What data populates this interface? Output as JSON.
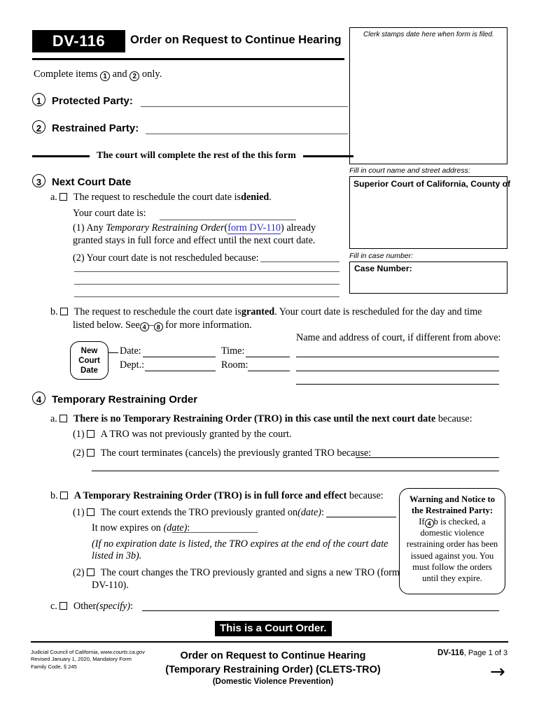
{
  "header": {
    "form_code": "DV-116",
    "title": "Order on Request to Continue Hearing",
    "complete_items_prefix": "Complete items",
    "complete_items_mid": "and",
    "complete_items_suffix": "only.",
    "item1": "1",
    "item2": "2"
  },
  "clerk_box": {
    "label": "Clerk stamps date here when form is filed."
  },
  "parties": {
    "num1": "1",
    "label1": "Protected Party:",
    "num2": "2",
    "label2": "Restrained Party:",
    "divider_text": "The court will complete the rest of the this form"
  },
  "court_info": {
    "court_name_label": "Fill in court name and street address:",
    "court_name_value": "Superior Court of California, County of",
    "case_number_label": "Fill in case number:",
    "case_number_value": "Case Number:"
  },
  "section3": {
    "number": "3",
    "heading": "Next Court Date",
    "a_letter": "a.",
    "a_text_1": "The request to reschedule the court date is",
    "a_text_bold": "denied",
    "a_text_end": ".",
    "a_courtdate_label": "Your court date is:",
    "a1_num": "(1)",
    "a1_pre": "Any",
    "a1_italic": "Temporary Restraining Order",
    "a1_paren_open": "(",
    "a1_link": "form DV-110",
    "a1_paren_close": ")",
    "a1_post": "already",
    "a1_line2": "granted stays in full force and effect until the next court date.",
    "a2_num": "(2)",
    "a2_text": "Your court date is not rescheduled because:",
    "b_letter": "b.",
    "b_text_1": "The request to reschedule the court date is",
    "b_text_bold": "granted",
    "b_text_2": ". Your court date is rescheduled for the day and time",
    "b_line2_pre": "listed below. See",
    "b_ref_from": "4",
    "b_ref_dash": "–",
    "b_ref_to": "8",
    "b_line2_post": "for more information.",
    "new_court_date_pill": "New\nCourt\nDate",
    "ncd_line1": "New",
    "ncd_line2": "Court",
    "ncd_line3": "Date",
    "field_date": "Date:",
    "field_time": "Time:",
    "field_dept": "Dept.:",
    "field_room": "Room:",
    "address_label": "Name and address of court, if different from above:"
  },
  "section4": {
    "number": "4",
    "heading": "Temporary Restraining Order",
    "a_letter": "a.",
    "a_bold": "There is no Temporary Restraining Order (TRO) in this case until the next court date",
    "a_tail": "because:",
    "a1_num": "(1)",
    "a1_text": "A TRO was not previously granted by the court.",
    "a2_num": "(2)",
    "a2_text": "The court terminates (cancels) the previously granted TRO because:",
    "b_letter": "b.",
    "b_bold": "A Temporary Restraining Order (TRO) is in full force and effect",
    "b_tail": "because:",
    "b1_num": "(1)",
    "b1_text": "The court extends the TRO previously granted on",
    "b1_date_italic": "(date)",
    "b1_colon": ":",
    "b1_expires_pre": "It now expires on",
    "b1_expires_italic": "(date)",
    "b1_expires_colon": ":",
    "b1_note_line1": "(If no expiration date is listed, the TRO expires at the end of the court date",
    "b1_note_line2": "listed in 3b).",
    "b2_num": "(2)",
    "b2_text_line1": "The court changes the TRO previously granted and signs a new TRO (form",
    "b2_text_line2": "DV-110).",
    "c_letter": "c.",
    "c_text": "Other",
    "c_italic": "(specify)",
    "c_colon": ":"
  },
  "warning": {
    "title_line1": "Warning and Notice to",
    "title_line2": "the Restrained Party:",
    "body_pre": "If",
    "body_ref": "4",
    "body_post": "b is checked, a domestic violence restraining order has been issued against you. You must follow the orders until they expire."
  },
  "banner": {
    "court_order": "This is a Court Order."
  },
  "footer": {
    "left_line1_a": "Judicial Council of California,",
    "left_line1_b": "www.courts.ca.gov",
    "left_line2": "Revised January 1, 2020, Mandatory Form",
    "left_line3": "Family Code, § 245",
    "center_line1": "Order on Request to Continue Hearing",
    "center_line2": "(Temporary Restraining Order) (CLETS-TRO)",
    "center_line3": "(Domestic Violence Prevention)",
    "right_code": "DV-116",
    "right_page": ", Page 1 of 3",
    "arrow": "→"
  },
  "colors": {
    "ink": "#000000",
    "link": "#2b2bbf",
    "rule": "#555555"
  }
}
